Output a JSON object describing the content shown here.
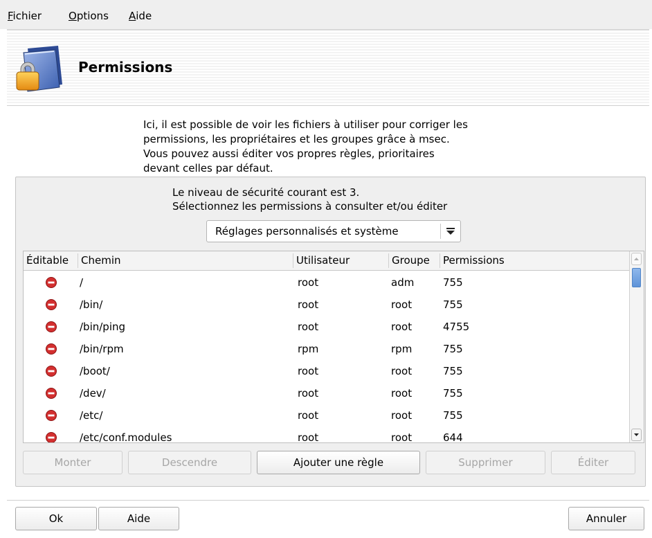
{
  "menu": {
    "items": [
      {
        "label": "Fichier",
        "accel": "F",
        "rest": "ichier"
      },
      {
        "label": "Options",
        "accel": "O",
        "rest": "ptions"
      },
      {
        "label": "Aide",
        "accel": "A",
        "rest": "ide"
      }
    ]
  },
  "banner": {
    "title": "Permissions",
    "icon": "folder-lock-icon"
  },
  "intro": "Ici, il est possible de voir les fichiers à utiliser pour corriger les\npermissions, les propriétaires et les groupes grâce à msec.\nVous pouvez aussi éditer vos propres règles, prioritaires\ndevant celles par défaut.",
  "security": {
    "text": "Le niveau de sécurité courant est 3.\nSélectionnez les permissions à consulter et/ou éditer",
    "level": 3,
    "selected_option": "Réglages personnalisés et système"
  },
  "table": {
    "columns": [
      "Éditable",
      "Chemin",
      "Utilisateur",
      "Groupe",
      "Permissions"
    ],
    "rows": [
      {
        "editable": false,
        "path": "/",
        "user": "root",
        "group": "adm",
        "perms": "755"
      },
      {
        "editable": false,
        "path": "/bin/",
        "user": "root",
        "group": "root",
        "perms": "755"
      },
      {
        "editable": false,
        "path": "/bin/ping",
        "user": "root",
        "group": "root",
        "perms": "4755"
      },
      {
        "editable": false,
        "path": "/bin/rpm",
        "user": "rpm",
        "group": "rpm",
        "perms": "755"
      },
      {
        "editable": false,
        "path": "/boot/",
        "user": "root",
        "group": "root",
        "perms": "755"
      },
      {
        "editable": false,
        "path": "/dev/",
        "user": "root",
        "group": "root",
        "perms": "755"
      },
      {
        "editable": false,
        "path": "/etc/",
        "user": "root",
        "group": "root",
        "perms": "755"
      },
      {
        "editable": false,
        "path": "/etc/conf.modules",
        "user": "root",
        "group": "root",
        "perms": "644"
      }
    ]
  },
  "actions": {
    "up": "Monter",
    "down": "Descendre",
    "add": "Ajouter une règle",
    "delete": "Supprimer",
    "edit": "Éditer"
  },
  "footer": {
    "ok": "Ok",
    "help": "Aide",
    "cancel": "Annuler"
  },
  "colors": {
    "forbidden_icon": "#d32f2f",
    "scroll_thumb": "#6a9fe0"
  }
}
